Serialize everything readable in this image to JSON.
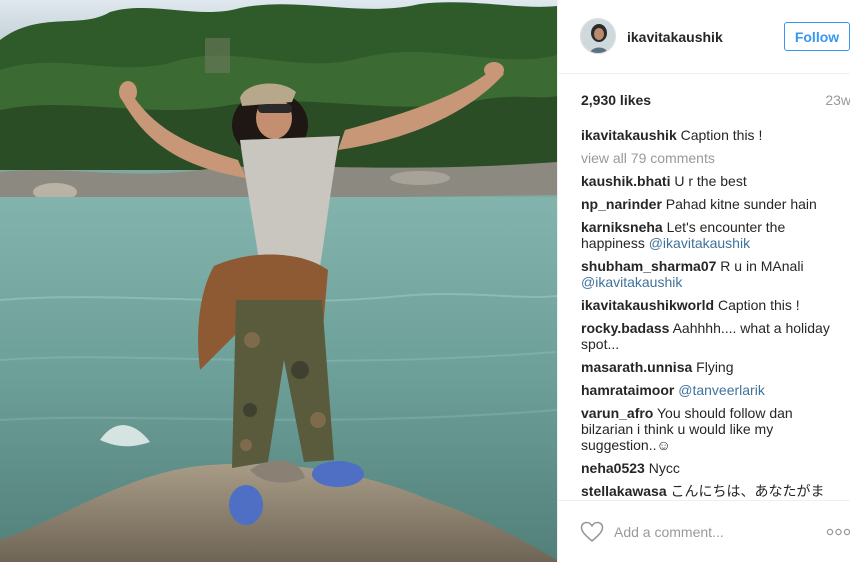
{
  "post": {
    "username": "ikavitakaushik",
    "follow_label": "Follow",
    "likes": "2,930 likes",
    "time": "23w"
  },
  "comments": {
    "first": {
      "user": "ikavitakaushik",
      "text": "Caption this !"
    },
    "view_all": "view all 79 comments",
    "items": [
      {
        "user": "kaushik.bhati",
        "text": "U r the best"
      },
      {
        "user": "np_narinder",
        "text": "Pahad kitne sunder hain"
      },
      {
        "user": "karniksneha",
        "text": "Let's encounter the happiness",
        "mention": "@ikavitakaushik"
      },
      {
        "user": "shubham_sharma07",
        "text": "R u in MAnali",
        "mention": "@ikavitakaushik"
      },
      {
        "user": "ikavitakaushikworld",
        "text": "Caption this !"
      },
      {
        "user": "rocky.badass",
        "text": "Aahhhh.... what a holiday spot..."
      },
      {
        "user": "masarath.unnisa",
        "text": "Flying"
      },
      {
        "user": "hamrataimoor",
        "text": "",
        "mention": "@tanveerlarik"
      },
      {
        "user": "varun_afro",
        "text": "You should follow dan bilzarian i think u would like my suggestion..☺"
      },
      {
        "user": "neha0523",
        "text": "Nycc"
      },
      {
        "user": "stellakawasa",
        "text": "こんにちは、あなたがまる方"
      }
    ]
  },
  "footer": {
    "add_comment_placeholder": "Add a comment..."
  },
  "icons": {
    "heart": "heart-outline-icon",
    "more": "more-options-icon"
  },
  "colors": {
    "follow_blue": "#3897f0",
    "mention_blue": "#3f729b",
    "muted_gray": "#999999"
  }
}
